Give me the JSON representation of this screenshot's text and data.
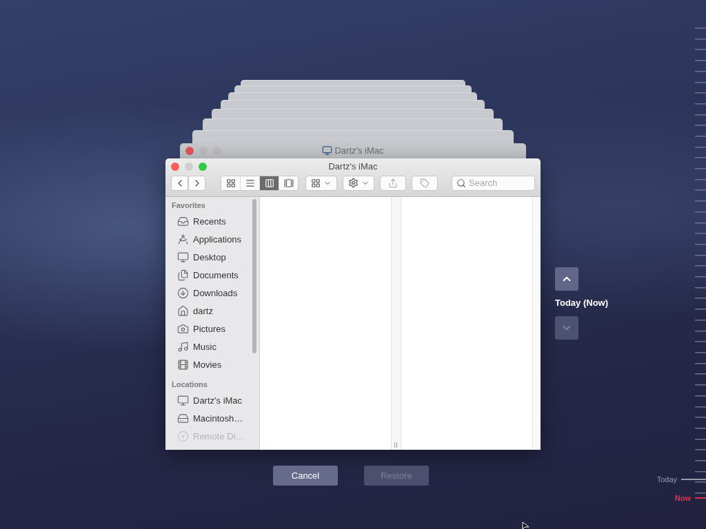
{
  "back_window": {
    "title": "Dartz's iMac"
  },
  "window": {
    "title": "Dartz's iMac"
  },
  "toolbar": {
    "view_modes": [
      {
        "kind": "icons",
        "selected": false
      },
      {
        "kind": "list",
        "selected": false
      },
      {
        "kind": "columns",
        "selected": true
      },
      {
        "kind": "gallery",
        "selected": false
      }
    ],
    "search": {
      "placeholder": "Search"
    }
  },
  "sidebar": {
    "sections": [
      {
        "heading": "Favorites",
        "items": [
          {
            "label": "Recents",
            "kind": "recents",
            "disabled": false
          },
          {
            "label": "Applications",
            "kind": "applications",
            "disabled": false
          },
          {
            "label": "Desktop",
            "kind": "desktop",
            "disabled": false
          },
          {
            "label": "Documents",
            "kind": "documents",
            "disabled": false
          },
          {
            "label": "Downloads",
            "kind": "downloads",
            "disabled": false
          },
          {
            "label": "dartz",
            "kind": "home",
            "disabled": false
          },
          {
            "label": "Pictures",
            "kind": "pictures",
            "disabled": false
          },
          {
            "label": "Music",
            "kind": "music",
            "disabled": false
          },
          {
            "label": "Movies",
            "kind": "movies",
            "disabled": false
          }
        ]
      },
      {
        "heading": "Locations",
        "items": [
          {
            "label": "Dartz's iMac",
            "kind": "computer",
            "disabled": false
          },
          {
            "label": "Macintosh…",
            "kind": "disk",
            "disabled": false
          },
          {
            "label": "Remote Di…",
            "kind": "disc",
            "disabled": true
          }
        ]
      }
    ]
  },
  "navigator": {
    "label": "Today (Now)",
    "up": {
      "disabled": false
    },
    "down": {
      "disabled": true
    }
  },
  "buttons": [
    {
      "label": "Cancel",
      "disabled": false
    },
    {
      "label": "Restore",
      "disabled": true
    }
  ],
  "timeline": {
    "marks": [
      {
        "label": "Today",
        "kind": "today"
      },
      {
        "label": "Now",
        "kind": "now"
      }
    ]
  }
}
